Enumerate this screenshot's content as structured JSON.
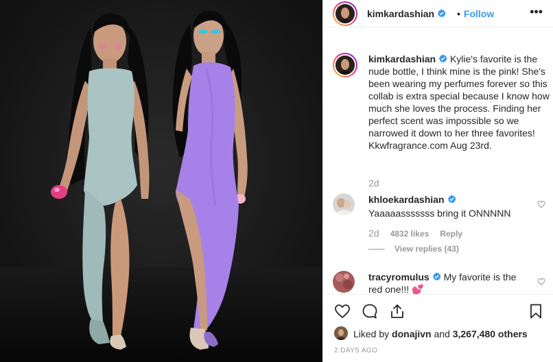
{
  "post": {
    "username": "kimkardashian",
    "dot": "•",
    "follow_label": "Follow",
    "more_label": "•••"
  },
  "caption": {
    "username": "kimkardashian",
    "text": "Kylie's favorite is the nude bottle, I think mine is the pink! She's been wearing my perfumes forever so this collab is extra special because I know how much she loves the process. Finding her perfect scent was impossible so we narrowed it down to her three favorites! Kkwfragrance.com Aug 23rd.",
    "age": "2d"
  },
  "comments": [
    {
      "username": "khloekardashian",
      "text": "Yaaaaasssssss bring it ONNNNN",
      "age": "2d",
      "likes": "4832 likes",
      "reply_label": "Reply",
      "view_replies": "View replies (43)"
    },
    {
      "username": "tracyromulus",
      "text": "My favorite is the red one!!! 💕"
    }
  ],
  "likes": {
    "prefix": "Liked by ",
    "liker": "donajivn",
    "middle": " and ",
    "count": "3,267,480 others"
  },
  "time_ago": "2 DAYS AGO",
  "colors": {
    "accent": "#3897f0",
    "verified": "#3897f0",
    "muted": "#999999",
    "kim_bodysuit": "#a9c4c2",
    "kylie_bodysuit": "#a682e8"
  }
}
